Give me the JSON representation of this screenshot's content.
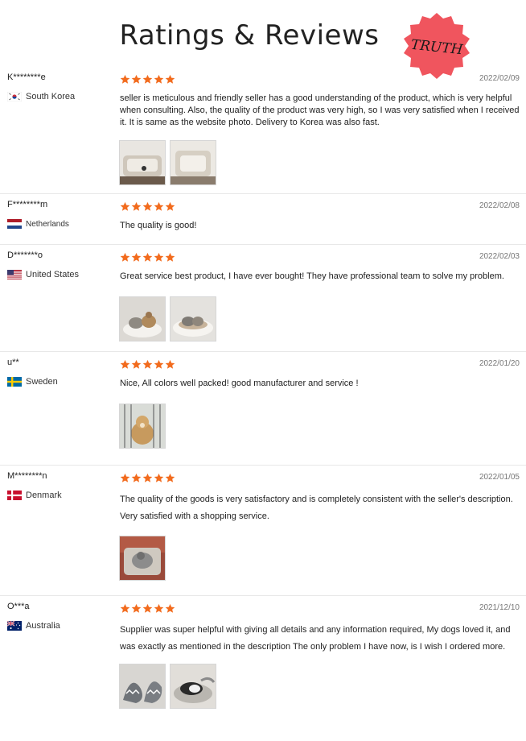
{
  "header": {
    "title": "Ratings & Reviews",
    "seal_text": "TRUTH",
    "seal_color": "#f0555e"
  },
  "colors": {
    "star": "#f26b1d",
    "date": "#777777"
  },
  "reviews": [
    {
      "user": "K********e",
      "country": "South Korea",
      "flag": "korea-flag-icon",
      "rating": 5,
      "date": "2022/02/09",
      "text": "seller is meticulous and friendly seller has a good understanding of the product, which is very helpful when consulting. Also, the quality of the product was very high, so I was very satisfied when I received it. It is same as the website photo. Delivery to Korea was also fast.",
      "photos": 2
    },
    {
      "user": "F********m",
      "country": "Netherlands",
      "flag": "netherlands-flag-icon",
      "rating": 5,
      "date": "2022/02/08",
      "text": "The quality is good!",
      "photos": 0
    },
    {
      "user": "D*******o",
      "country": "United States",
      "flag": "usa-flag-icon",
      "rating": 5,
      "date": "2022/02/03",
      "text": "Great service best product, I have ever bought! They have professional team to solve my problem.",
      "photos": 2
    },
    {
      "user": "u**",
      "country": "Sweden",
      "flag": "sweden-flag-icon",
      "rating": 5,
      "date": "2022/01/20",
      "text": "Nice, All colors well packed! good manufacturer and service !",
      "photos": 1
    },
    {
      "user": "M********n",
      "country": "Denmark",
      "flag": "denmark-flag-icon",
      "rating": 5,
      "date": "2022/01/05",
      "text": "The quality of the goods is very satisfactory and is completely consistent with the seller's description. Very satisfied with a shopping service.",
      "photos": 1
    },
    {
      "user": "O***a",
      "country": "Australia",
      "flag": "australia-flag-icon",
      "rating": 5,
      "date": "2021/12/10",
      "text": "Supplier was super helpful with giving all details and any information required, My dogs loved it, and was exactly as mentioned in the description The only problem I have now, is I wish I ordered more.",
      "photos": 2
    }
  ]
}
